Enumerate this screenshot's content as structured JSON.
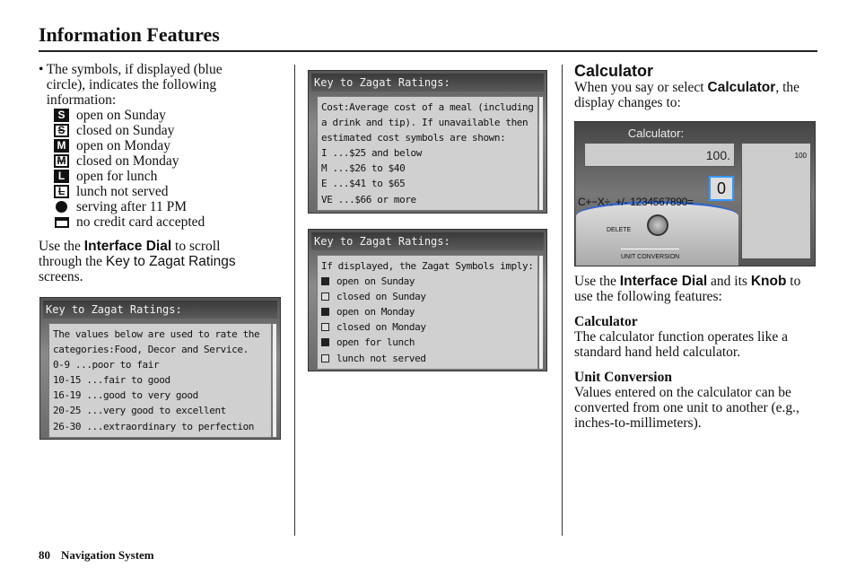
{
  "header": {
    "title": "Information Features"
  },
  "left": {
    "bullet_intro": "The symbols, if displayed (blue circle), indicates the following information:",
    "symbols": [
      {
        "icon": "S",
        "style": "fill",
        "label": "open on Sunday"
      },
      {
        "icon": "S",
        "style": "out",
        "label": "closed on Sunday"
      },
      {
        "icon": "M",
        "style": "fill",
        "label": "open on Monday"
      },
      {
        "icon": "M",
        "style": "out",
        "label": "closed on Monday"
      },
      {
        "icon": "L",
        "style": "fill",
        "label": "open for lunch"
      },
      {
        "icon": "L",
        "style": "out",
        "label": "lunch not served"
      },
      {
        "icon": "moon",
        "style": "moon",
        "label": "serving after 11 PM"
      },
      {
        "icon": "card",
        "style": "card",
        "label": "no credit card accepted"
      }
    ],
    "para_1": "Use the ",
    "para_dial": "Interface Dial",
    "para_2": " to scroll through the ",
    "para_key": "Key to Zagat Ratings",
    "para_3": " screens."
  },
  "screens": [
    {
      "title": "Key to Zagat Ratings:",
      "lines": [
        "The values below are used to rate the",
        "categories:Food, Decor and Service.",
        "0-9 ...poor to fair",
        "10-15 ...fair to good",
        "16-19 ...good to very good",
        "20-25 ...very good to excellent",
        "26-30 ...extraordinary to perfection"
      ]
    },
    {
      "title": "Key to Zagat Ratings:",
      "lines": [
        "Cost:Average cost of a meal (including",
        "a drink and tip). If unavailable then",
        "estimated cost symbols are shown:",
        "I ...$25 and below",
        "M ...$26 to $40",
        "E ...$41 to $65",
        "VE ...$66 or more"
      ]
    },
    {
      "title": "Key to Zagat Ratings:",
      "lines": [
        "If displayed, the Zagat Symbols imply:",
        "open on Sunday",
        "closed on Sunday",
        "open on Monday",
        "closed on Monday",
        "open for lunch",
        "lunch not served"
      ]
    }
  ],
  "right": {
    "heading": "Calculator",
    "intro_1": "When you say or select ",
    "intro_bold": "Calculator",
    "intro_2": ", the display changes to:",
    "calc": {
      "title": "Calculator:",
      "display": "100.",
      "history": "100",
      "selected": "0",
      "keys": "C+−X÷. +/- 1234567890=",
      "delete": "DELETE",
      "unit": "UNIT CONVERSION"
    },
    "use_1": "Use the ",
    "use_dial": "Interface Dial",
    "use_2": " and its ",
    "use_knob": "Knob",
    "use_3": " to use the following features:",
    "f1_title": "Calculator",
    "f1_text": "The calculator function operates like a standard hand held calculator.",
    "f2_title": "Unit Conversion",
    "f2_text": "Values entered on the calculator can be converted from one unit to another (e.g., inches-to-millimeters)."
  },
  "footer": {
    "page": "80",
    "section": "Navigation System"
  }
}
